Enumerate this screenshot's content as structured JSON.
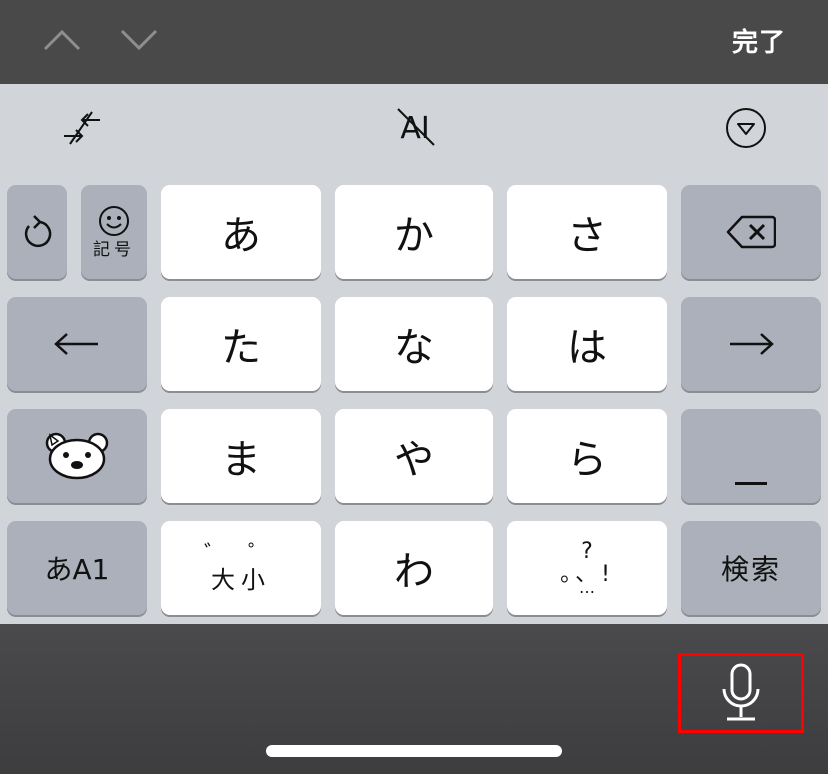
{
  "accessory_bar": {
    "done_label": "完了",
    "prev_icon": "chevron-up-icon",
    "next_icon": "chevron-down-icon"
  },
  "toolbar": {
    "left_icon": "compress-arrows-icon",
    "center_label": "AI",
    "right_icon": "circle-triangle-down-icon"
  },
  "keys": {
    "undo_icon": "undo-icon",
    "emoji_label": "記号",
    "row1": [
      "あ",
      "か",
      "さ"
    ],
    "backspace_icon": "delete-icon",
    "left_arrow": "←",
    "row2": [
      "た",
      "な",
      "は"
    ],
    "right_arrow": "→",
    "bear_icon": "bear-face-icon",
    "row3": [
      "ま",
      "や",
      "ら"
    ],
    "long_vowel": "ー",
    "mode_label": "あA1",
    "dakuten_marks": "゛゜",
    "daisho_label": "大小",
    "wa": "わ",
    "punct_top": "?",
    "punct_row": "。、!",
    "punct_dots": "…",
    "search_label": "検索"
  },
  "bottom": {
    "mic_icon": "microphone-icon"
  },
  "colors": {
    "accessory_bg": "#494949",
    "keyboard_bg": "#d1d4d9",
    "white_key": "#ffffff",
    "gray_key": "#abb0bb",
    "highlight_border": "#ff0000"
  }
}
